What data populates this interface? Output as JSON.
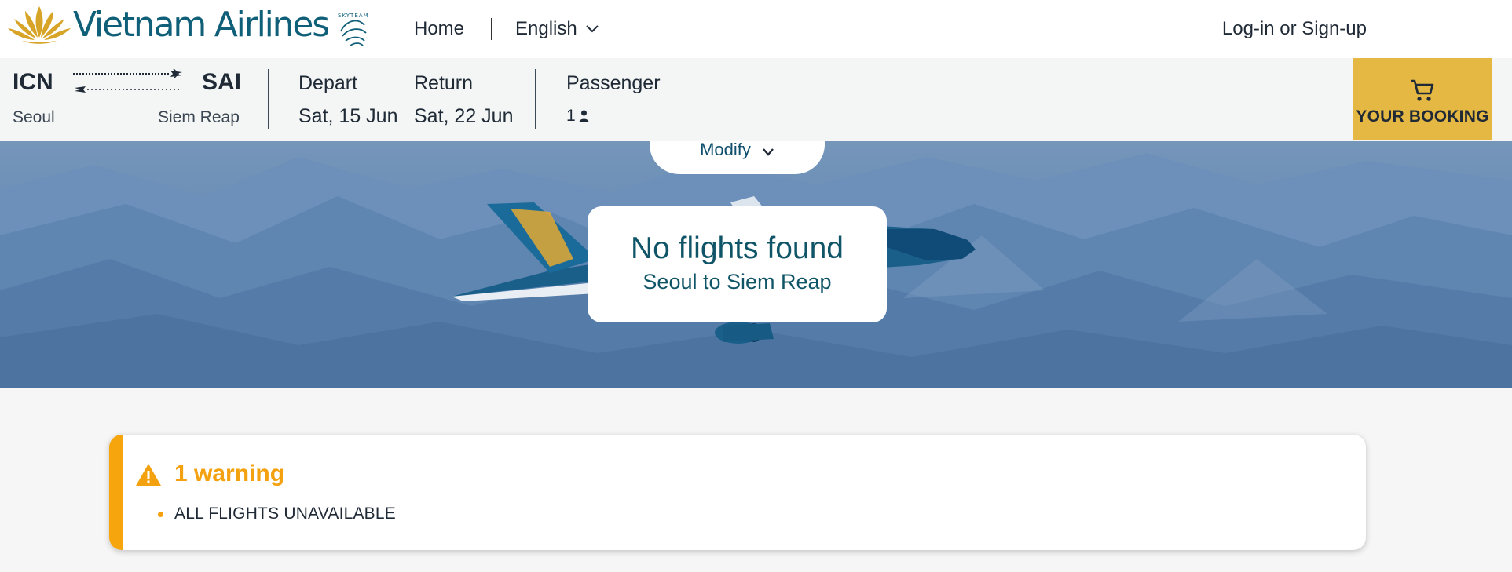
{
  "brand": {
    "name": "Vietnam Airlines",
    "alliance_mark": "SKYTEAM",
    "color": "#0f5f79",
    "lotus_color": "#d7a427"
  },
  "nav": {
    "home": "Home",
    "language": "English",
    "login": "Log-in or Sign-up"
  },
  "search": {
    "origin_code": "ICN",
    "origin_city": "Seoul",
    "destination_code": "SAI",
    "destination_city": "Siem Reap",
    "depart_label": "Depart",
    "depart_value": "Sat, 15 Jun",
    "return_label": "Return",
    "return_value": "Sat, 22 Jun",
    "passenger_label": "Passenger",
    "passenger_count": "1",
    "booking_label": "YOUR BOOKING",
    "booking_color": "#e5b743"
  },
  "hero": {
    "modify_label": "Modify",
    "title": "No flights found",
    "subtitle": "Seoul to Siem Reap"
  },
  "warning": {
    "title": "1 warning",
    "color": "#f7a50d",
    "items": [
      "ALL FLIGHTS UNAVAILABLE"
    ]
  }
}
